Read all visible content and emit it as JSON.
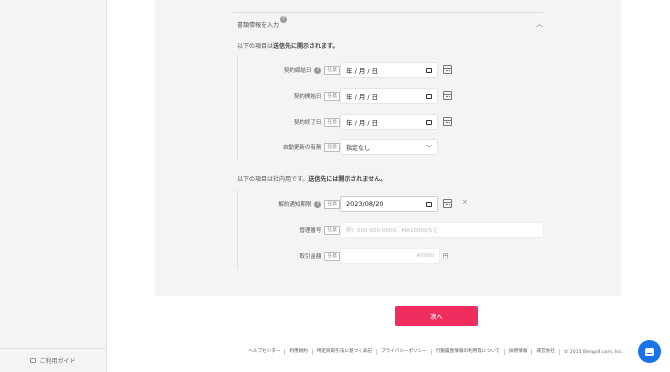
{
  "sidebar": {
    "guide_label": "ご利用ガイド"
  },
  "section": {
    "title": "書類情報を入力",
    "help": "?",
    "public_note_pre": "以下の項目は",
    "public_note_bold": "送信先に開示されます。",
    "internal_note_pre": "以下の項目は社内用です。",
    "internal_note_bold": "送信先には開示されません。"
  },
  "badge_optional": "任意",
  "public_fields": [
    {
      "label": "契約締結日",
      "help": "?",
      "value": "年 / 月 / 日"
    },
    {
      "label": "契約開始日",
      "value": "年 / 月 / 日"
    },
    {
      "label": "契約終了日",
      "value": "年 / 月 / 日"
    }
  ],
  "auto_renew": {
    "label": "自動更新の有無",
    "value": "指定なし"
  },
  "internal_fields": {
    "notice_deadline": {
      "label": "解約通知期限",
      "help": "?",
      "value": "2023/08/20",
      "clear": "×"
    },
    "management_no": {
      "label": "管理番号",
      "placeholder": "例）000-000-0000、MA10000など"
    },
    "amount": {
      "label": "取引金額",
      "placeholder": "40000",
      "unit": "円"
    }
  },
  "next_button": "次へ",
  "footer": {
    "links": [
      "ヘルプセンター",
      "利用規約",
      "特定商取引法に基づく表記",
      "プライバシーポリシー",
      "行動履歴情報の利用等について",
      "採用情報",
      "運営会社"
    ],
    "copyright": "© 2015 Bengo4.com, Inc."
  },
  "icons": [
    "calendar-icon",
    "chevron-up-icon",
    "chevron-down-icon",
    "clear-icon",
    "help-icon",
    "guide-icon",
    "chat-icon"
  ],
  "colors": {
    "primary": "#ee2c5e",
    "chat": "#1a73e8"
  }
}
